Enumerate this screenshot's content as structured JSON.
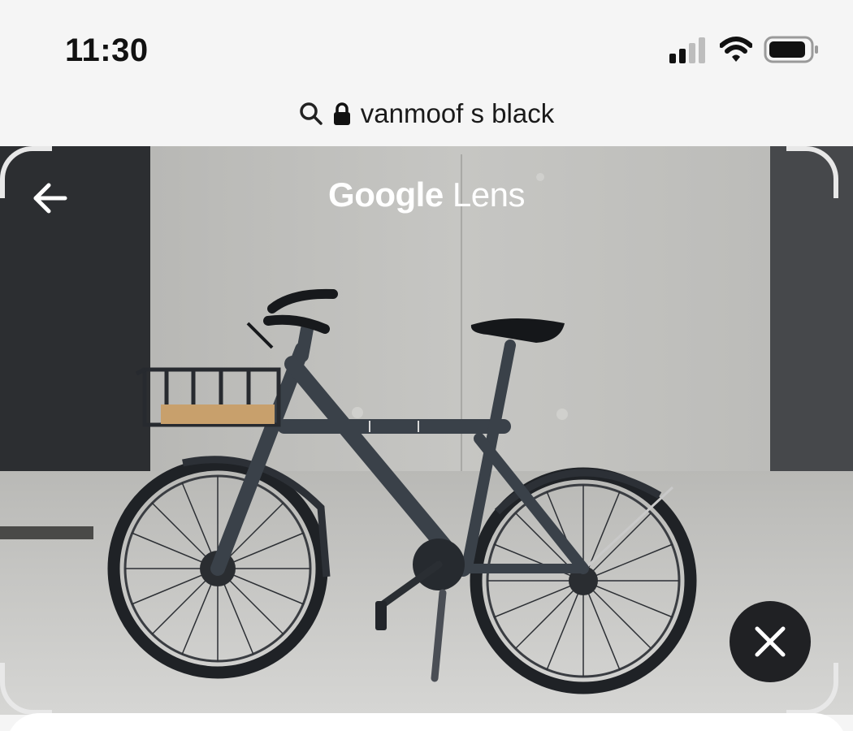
{
  "status_bar": {
    "time": "11:30",
    "icons": [
      "cellular-signal-icon",
      "wifi-icon",
      "battery-icon"
    ]
  },
  "url_bar": {
    "query": "vanmoof s black",
    "icons": [
      "search-icon",
      "lock-icon"
    ]
  },
  "lens": {
    "brand": "Google",
    "product": "Lens",
    "back_icon": "arrow-left-icon",
    "close_icon": "close-icon"
  },
  "colors": {
    "background": "#f5f5f5",
    "close_button": "#202124",
    "bike_frame": "#3a4149",
    "wall": "#c2c2bf"
  }
}
